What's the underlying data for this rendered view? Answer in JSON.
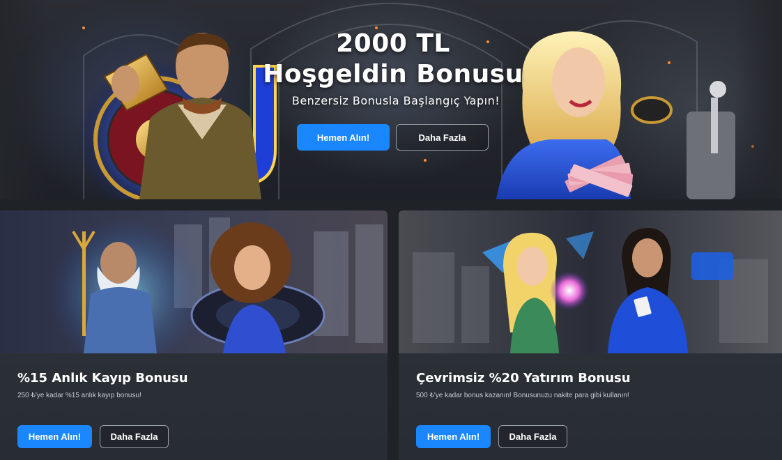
{
  "hero": {
    "amount": "2000 TL",
    "headline": "Hoşgeldin Bonusu",
    "subtitle": "Benzersiz Bonusla Başlangıç Yapın!",
    "primary_button": "Hemen Alın!",
    "secondary_button": "Daha Fazla"
  },
  "promos": [
    {
      "title": "%15 Anlık Kayıp Bonusu",
      "description": "250 ₺'ye kadar %15 anlık kayıp bonusu!",
      "primary_button": "Hemen Alın!",
      "secondary_button": "Daha Fazla"
    },
    {
      "title": "Çevrimsiz %20 Yatırım Bonusu",
      "description": "500 ₺'ye kadar bonus kazanın! Bonusunuzu nakite para gibi kullanın!",
      "primary_button": "Hemen Alın!",
      "secondary_button": "Daha Fazla"
    }
  ],
  "colors": {
    "page_background": "#1f2328",
    "primary_button": "#1a86ff",
    "card_background": "#2f353d"
  }
}
